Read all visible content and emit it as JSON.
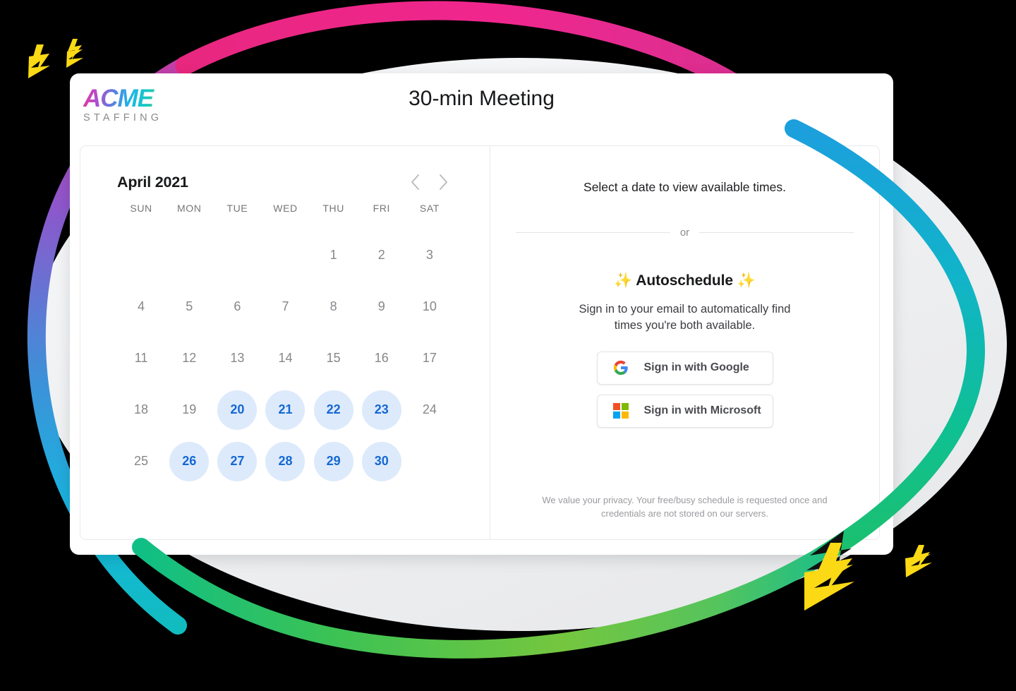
{
  "brand": {
    "name": "ACME",
    "subtitle": "STAFFING",
    "gradient_from": "#e5379b",
    "gradient_mid": "#1ab5e8",
    "gradient_to": "#86cc52"
  },
  "header": {
    "title": "30-min Meeting"
  },
  "calendar": {
    "month_label": "April 2021",
    "prev_label": "Previous month",
    "next_label": "Next month",
    "weekdays": [
      "SUN",
      "MON",
      "TUE",
      "WED",
      "THU",
      "FRI",
      "SAT"
    ],
    "leading_blanks": 4,
    "days": [
      {
        "n": 1,
        "available": false
      },
      {
        "n": 2,
        "available": false
      },
      {
        "n": 3,
        "available": false
      },
      {
        "n": 4,
        "available": false
      },
      {
        "n": 5,
        "available": false
      },
      {
        "n": 6,
        "available": false
      },
      {
        "n": 7,
        "available": false
      },
      {
        "n": 8,
        "available": false
      },
      {
        "n": 9,
        "available": false
      },
      {
        "n": 10,
        "available": false
      },
      {
        "n": 11,
        "available": false
      },
      {
        "n": 12,
        "available": false
      },
      {
        "n": 13,
        "available": false
      },
      {
        "n": 14,
        "available": false
      },
      {
        "n": 15,
        "available": false
      },
      {
        "n": 16,
        "available": false
      },
      {
        "n": 17,
        "available": false
      },
      {
        "n": 18,
        "available": false
      },
      {
        "n": 19,
        "available": false
      },
      {
        "n": 20,
        "available": true
      },
      {
        "n": 21,
        "available": true
      },
      {
        "n": 22,
        "available": true
      },
      {
        "n": 23,
        "available": true
      },
      {
        "n": 24,
        "available": false
      },
      {
        "n": 25,
        "available": false
      },
      {
        "n": 26,
        "available": true
      },
      {
        "n": 27,
        "available": true
      },
      {
        "n": 28,
        "available": true
      },
      {
        "n": 29,
        "available": true
      },
      {
        "n": 30,
        "available": true
      }
    ],
    "available_bg": "#ddeafb",
    "available_color": "#1568d4",
    "unavailable_color": "#86878b"
  },
  "right_panel": {
    "select_message": "Select a date to view available times.",
    "divider_label": "or",
    "autoschedule_title": "✨ Autoschedule ✨",
    "autoschedule_description": "Sign in to your email to automatically find times you're both available.",
    "buttons": [
      {
        "id": "google",
        "label": "Sign in with Google",
        "icon": "google-icon"
      },
      {
        "id": "microsoft",
        "label": "Sign in with Microsoft",
        "icon": "microsoft-icon"
      }
    ],
    "privacy_note": "We value your privacy. Your free/busy schedule is requested once and credentials are not stored on our servers."
  },
  "decoration": {
    "arc_top_color": "#ec2f8c",
    "arc_left_color": "#9b52c9",
    "arc_right_color": "#1aa0dc",
    "arc_bottom_color": "#74c63f",
    "bolt_color": "#fbd914",
    "backdrop_color": "#eeeff0"
  }
}
